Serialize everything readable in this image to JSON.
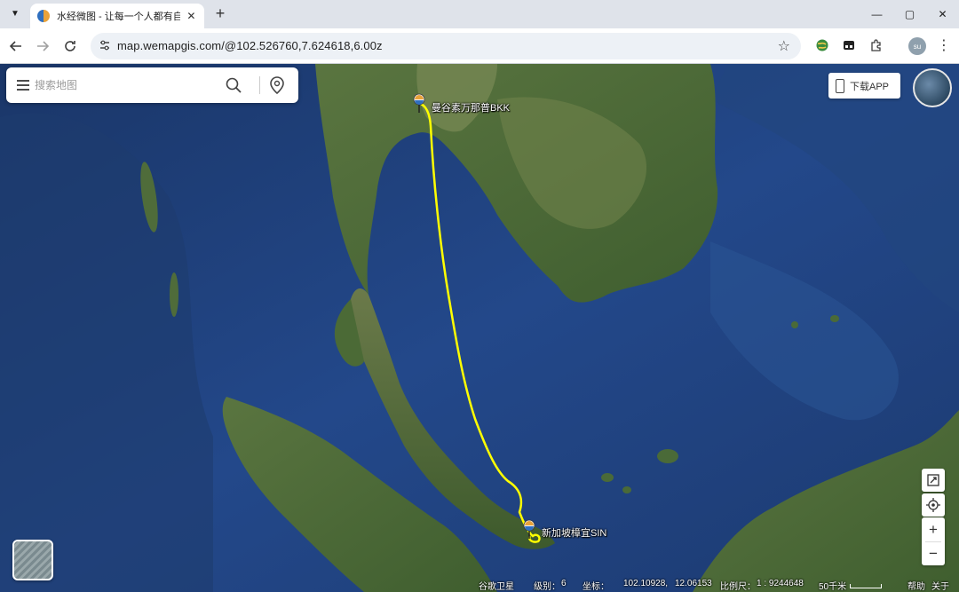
{
  "tab": {
    "title": "水经微图 - 让每一个人都有自己的地图",
    "close": "✕"
  },
  "new_tab": "+",
  "window_controls": {
    "minimize": "—",
    "maximize": "▢",
    "close": "✕"
  },
  "toolbar": {
    "url": "map.wemapgis.com/@102.526760,7.624618,6.00z",
    "avatar_initials": "su"
  },
  "search": {
    "placeholder": "搜索地图"
  },
  "download_app_label": "下载APP",
  "route": {
    "color": "#ffff00",
    "origin_label": "曼谷素万那普BKK",
    "destination_label": "新加坡樟宜SIN"
  },
  "status": {
    "source": "谷歌卫星",
    "level_label": "级别：",
    "level_value": "6",
    "coord_label": "坐标：",
    "lon": "102.10928,",
    "lat": "12.06153",
    "scale_label": "比例尺：",
    "scale_value": "1 : 9244648",
    "scale_bar_label": "50千米",
    "help": "帮助",
    "about": "关于"
  },
  "colors": {
    "ocean": "#1f3f7a",
    "land": "#4d6b3a",
    "route": "#ffff00"
  }
}
